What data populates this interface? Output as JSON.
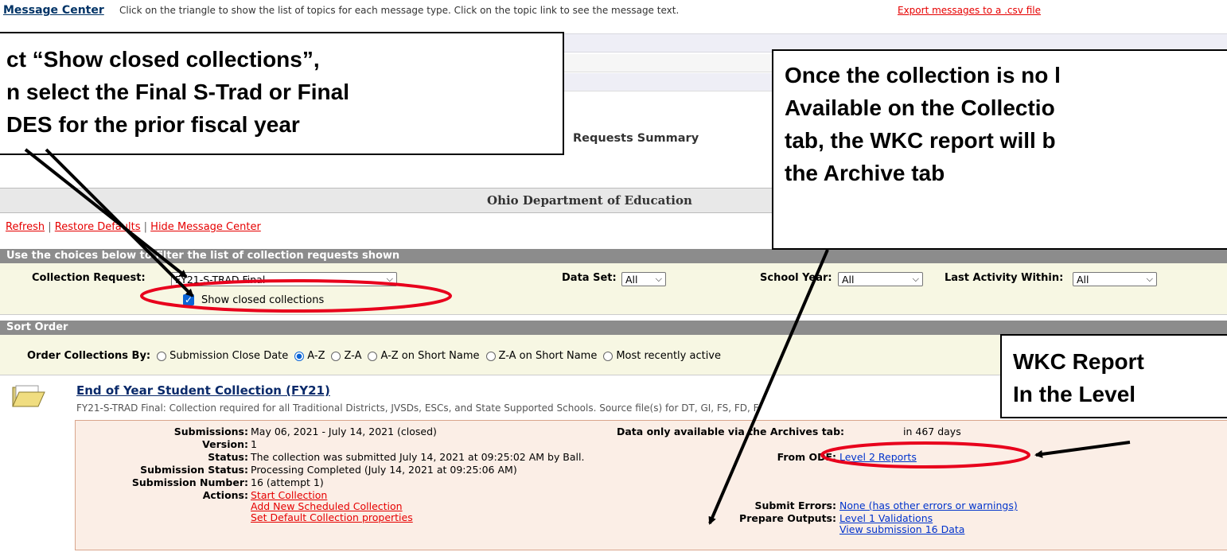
{
  "message_center": {
    "title": "Message Center",
    "instructions": "Click on the triangle to show the list of topics for each message type. Click on the topic link to see the message text.",
    "export_link": "Export messages to a .csv file"
  },
  "header": {
    "requests_summary": "Requests Summary",
    "org_title": "Ohio Department of Education"
  },
  "links": {
    "refresh": "Refresh",
    "restore_defaults": "Restore Defaults",
    "hide_message_center": "Hide Message Center",
    "separator": "|"
  },
  "filter": {
    "heading": "Use the choices below to filter the list of collection requests shown",
    "collection_request_label": "Collection Request:",
    "collection_request_value": "FY21-S-TRAD Final",
    "data_set_label": "Data Set:",
    "data_set_value": "All",
    "school_year_label": "School Year:",
    "school_year_value": "All",
    "last_activity_label": "Last Activity Within:",
    "last_activity_value": "All",
    "show_closed_label": "Show closed collections",
    "show_closed_checked": true
  },
  "sort": {
    "heading": "Sort Order",
    "order_label": "Order Collections By:",
    "options": [
      {
        "label": "Submission Close Date",
        "selected": false
      },
      {
        "label": "A-Z",
        "selected": true
      },
      {
        "label": "Z-A",
        "selected": false
      },
      {
        "label": "A-Z on Short Name",
        "selected": false
      },
      {
        "label": "Z-A on Short Name",
        "selected": false
      },
      {
        "label": "Most recently active",
        "selected": false
      }
    ]
  },
  "collection": {
    "icon": "folder-icon",
    "title": "End of Year Student Collection (FY21)",
    "description": "FY21-S-TRAD Final: Collection required for all Traditional Districts, JVSDs, ESCs, and State Supported Schools. Source file(s) for DT, GI, FS, FD, F",
    "submissions_label": "Submissions:",
    "submissions_value": "May 06, 2021 - July 14, 2021 (closed)",
    "version_label": "Version:",
    "version_value": "1",
    "status_label": "Status:",
    "status_value": "The collection was submitted July 14, 2021 at 09:25:02 AM by Ball.",
    "submission_status_label": "Submission Status:",
    "submission_status_value": "Processing Completed (July 14, 2021 at 09:25:06 AM)",
    "submission_number_label": "Submission Number:",
    "submission_number_value": "16 (attempt 1)",
    "actions_label": "Actions:",
    "actions": [
      "Start Collection",
      "Add New Scheduled Collection",
      "Set Default Collection properties"
    ],
    "archive_label": "Data only available via the Archives tab:",
    "archive_value": "in 467 days",
    "from_ode_label": "From ODE:",
    "from_ode_link": "Level 2 Reports",
    "submit_errors_label": "Submit Errors:",
    "submit_errors_link": "None (has other errors or warnings)",
    "prepare_outputs_label": "Prepare Outputs:",
    "prepare_outputs_links": [
      "Level 1 Validations",
      "View submission 16 Data"
    ]
  },
  "callouts": {
    "left": [
      "ct “Show closed collections”,",
      "n select the Final S-Trad or Final",
      "DES for the prior fiscal year"
    ],
    "right": [
      "Once the collection is no l",
      "Available on the Collectio",
      "tab, the WKC report will b",
      "the Archive tab"
    ],
    "bottom_right": [
      "WKC Report",
      "In the Level"
    ]
  },
  "colors": {
    "annotation_red": "#e8001c",
    "link_blue": "#0033cc",
    "action_red": "#e60000",
    "filter_bg": "#f7f7e3",
    "info_bg": "#fbeee6"
  }
}
